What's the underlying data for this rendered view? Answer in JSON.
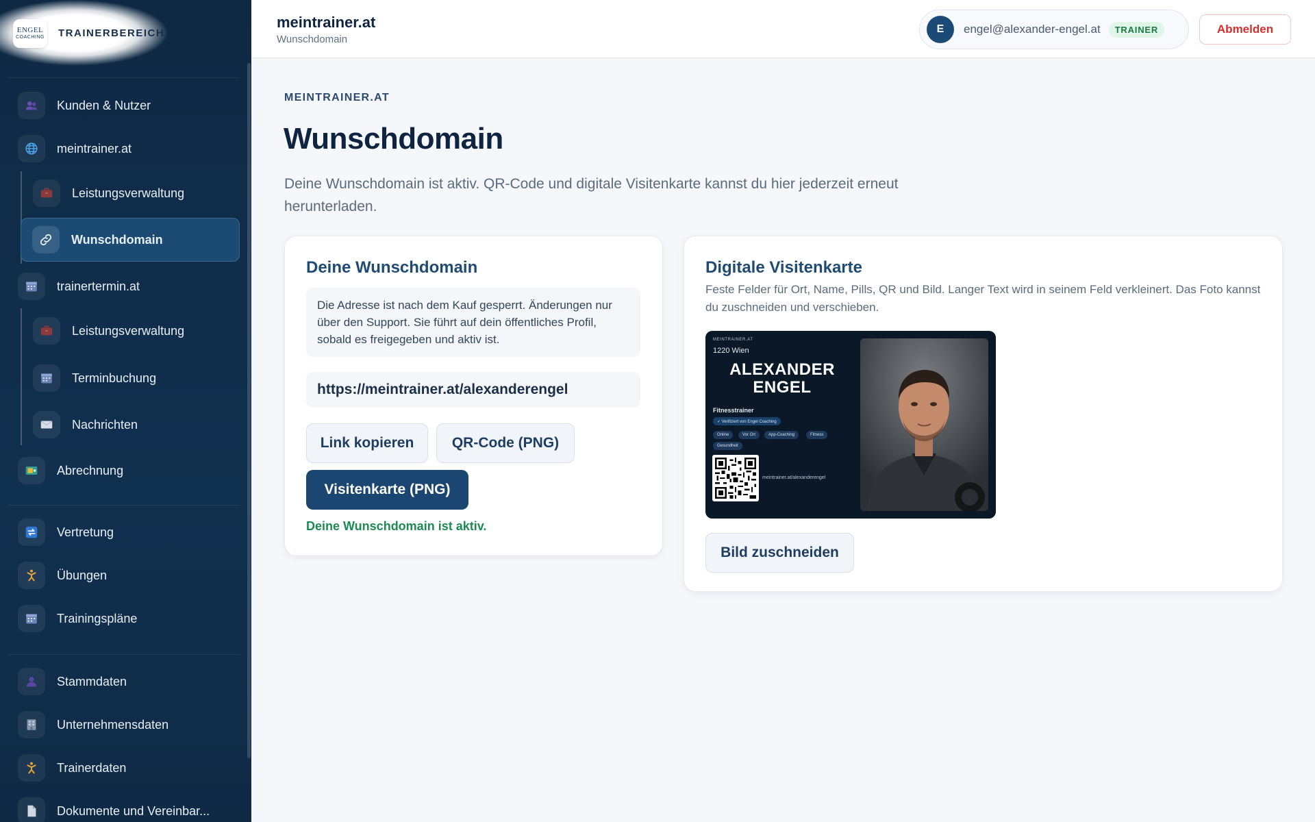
{
  "brand": {
    "logo_line1": "ENGEL",
    "logo_line2": "COACHING",
    "title": "TRAINERBEREICH"
  },
  "sidebar": {
    "items": [
      {
        "label": "Kunden & Nutzer",
        "icon": "users-icon"
      },
      {
        "label": "meintrainer.at",
        "icon": "globe-icon"
      },
      {
        "label": "Leistungsverwaltung",
        "icon": "briefcase-icon"
      },
      {
        "label": "Wunschdomain",
        "icon": "link-icon",
        "active": true
      },
      {
        "label": "trainertermin.at",
        "icon": "calendar-icon"
      },
      {
        "label": "Leistungsverwaltung",
        "icon": "briefcase-icon"
      },
      {
        "label": "Terminbuchung",
        "icon": "calendar-icon"
      },
      {
        "label": "Nachrichten",
        "icon": "envelope-icon"
      },
      {
        "label": "Abrechnung",
        "icon": "billing-icon"
      },
      {
        "label": "Vertretung",
        "icon": "swap-icon"
      },
      {
        "label": "Übungen",
        "icon": "exercise-icon"
      },
      {
        "label": "Trainingspläne",
        "icon": "calendar-icon"
      },
      {
        "label": "Stammdaten",
        "icon": "person-icon"
      },
      {
        "label": "Unternehmensdaten",
        "icon": "building-icon"
      },
      {
        "label": "Trainerdaten",
        "icon": "exercise-icon"
      },
      {
        "label": "Dokumente und Vereinbar...",
        "icon": "document-icon"
      }
    ]
  },
  "header": {
    "title": "meintrainer.at",
    "subtitle": "Wunschdomain",
    "user_initial": "E",
    "user_email": "engel@alexander-engel.at",
    "role": "TRAINER",
    "logout_label": "Abmelden"
  },
  "page": {
    "eyebrow": "MEINTRAINER.AT",
    "title": "Wunschdomain",
    "description": "Deine Wunschdomain ist aktiv. QR-Code und digitale Visitenkarte kannst du hier jederzeit erneut herunterladen."
  },
  "domain_card": {
    "title": "Deine Wunschdomain",
    "info": "Die Adresse ist nach dem Kauf gesperrt. Änderungen nur über den Support. Sie führt auf dein öffentliches Profil, sobald es freigegeben und aktiv ist.",
    "url": "https://meintrainer.at/alexanderengel",
    "copy_label": "Link kopieren",
    "qr_label": "QR-Code (PNG)",
    "card_label": "Visitenkarte (PNG)",
    "status": "Deine Wunschdomain ist aktiv."
  },
  "vcard": {
    "title": "Digitale Visitenkarte",
    "description": "Feste Felder für Ort, Name, Pills, QR und Bild. Langer Text wird in seinem Feld verkleinert. Das Foto kannst du zuschneiden und verschieben.",
    "crop_label": "Bild zuschneiden",
    "preview": {
      "domain": "MEINTRAINER.AT",
      "location": "1220 Wien",
      "name_line1": "ALEXANDER",
      "name_line2": "ENGEL",
      "role": "Fitnesstrainer",
      "verified": "✓ Verifiziert von Engel Coaching",
      "pills": [
        "Online",
        "Vor Ort",
        "App-Coaching",
        "Fitness",
        "Gesundheit"
      ],
      "url": "meintrainer.at/alexanderengel"
    }
  },
  "colors": {
    "sidebar": "#0f2944",
    "accent": "#1b4672",
    "success": "#1d8a53",
    "danger": "#d32f2f"
  }
}
